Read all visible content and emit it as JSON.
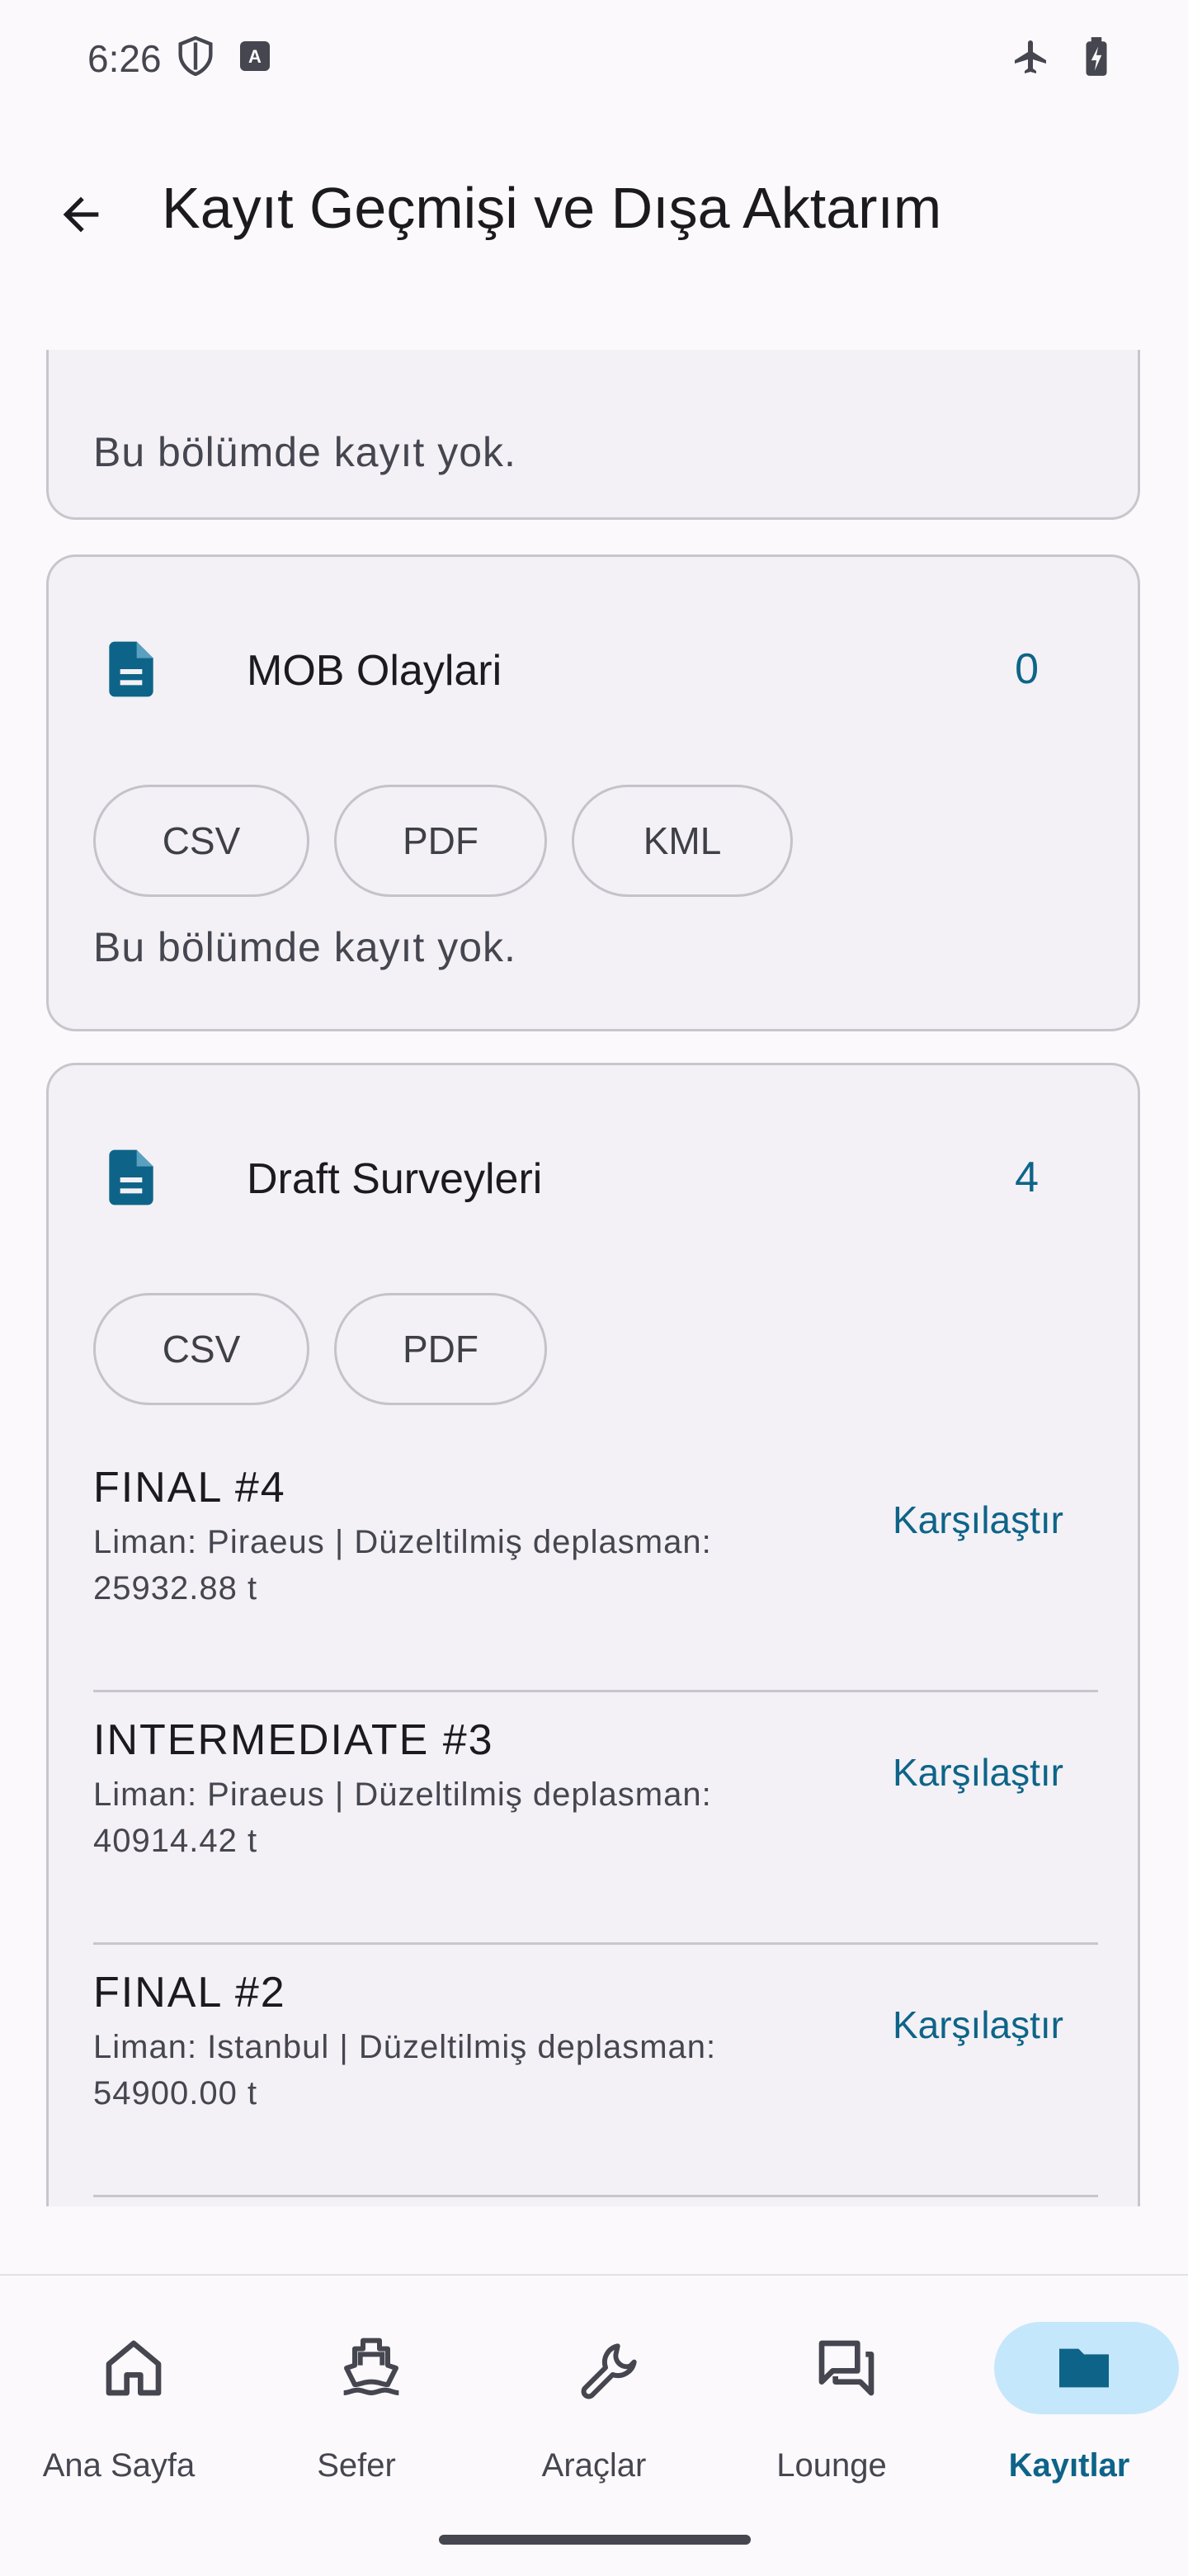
{
  "status_bar": {
    "time": "6:26"
  },
  "app_bar": {
    "title": "Kayıt Geçmişi ve Dışa Aktarım"
  },
  "partial_card": {
    "empty_text": "Bu bölümde kayıt yok."
  },
  "mob_card": {
    "title": "MOB Olaylari",
    "count": "0",
    "chips": [
      "CSV",
      "PDF",
      "KML"
    ],
    "empty_text": "Bu bölümde kayıt yok."
  },
  "draft_card": {
    "title": "Draft Surveyleri",
    "count": "4",
    "chips": [
      "CSV",
      "PDF"
    ],
    "compare_label": "Karşılaştır",
    "records": [
      {
        "title": "FINAL #4",
        "subtitle": "Liman: Piraeus | Düzeltilmiş deplasman: 25932.88 t"
      },
      {
        "title": "INTERMEDIATE #3",
        "subtitle": "Liman: Piraeus | Düzeltilmiş deplasman: 40914.42 t"
      },
      {
        "title": "FINAL #2",
        "subtitle": "Liman: Istanbul | Düzeltilmiş deplasman: 54900.00 t"
      }
    ]
  },
  "bottom_nav": {
    "items": [
      {
        "label": "Ana Sayfa",
        "icon": "home-icon"
      },
      {
        "label": "Sefer",
        "icon": "ship-icon"
      },
      {
        "label": "Araçlar",
        "icon": "wrench-icon"
      },
      {
        "label": "Lounge",
        "icon": "chat-icon"
      },
      {
        "label": "Kayıtlar",
        "icon": "folder-icon",
        "active": true
      }
    ]
  },
  "colors": {
    "accent": "#0e6488",
    "active_pill": "#c5e7fb",
    "card_bg": "#f3f1f6"
  }
}
